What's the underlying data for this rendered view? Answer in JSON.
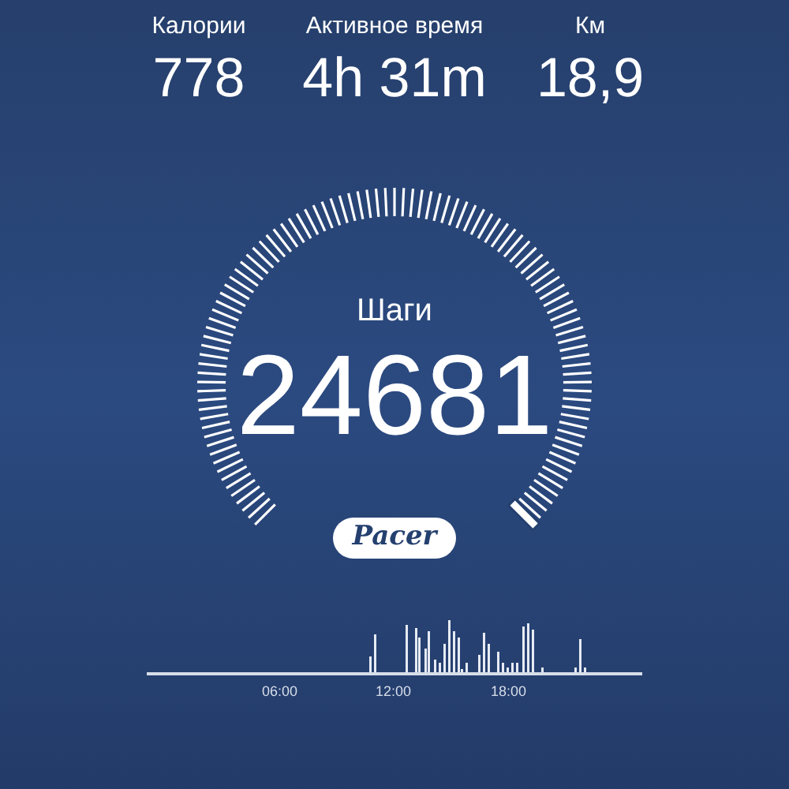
{
  "stats": [
    {
      "label": "Калории",
      "value": "778"
    },
    {
      "label": "Активное время",
      "value": "4h 31m"
    },
    {
      "label": "Км",
      "value": "18,9"
    }
  ],
  "steps": {
    "label": "Шаги",
    "value": "24681"
  },
  "logo": "Pacer",
  "activity": {
    "time_labels": [
      "06:00",
      "12:00",
      "18:00"
    ]
  }
}
